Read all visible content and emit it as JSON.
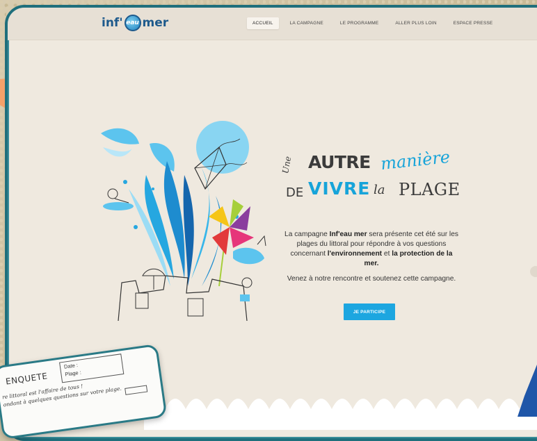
{
  "brand": {
    "logo_left": "inf'",
    "logo_globe": "eau",
    "logo_right": "mer"
  },
  "nav": {
    "items": [
      {
        "label": "ACCUEIL",
        "active": true
      },
      {
        "label": "LA CAMPAGNE",
        "active": false
      },
      {
        "label": "LE PROGRAMME",
        "active": false
      },
      {
        "label": "ALLER PLUS LOIN",
        "active": false
      },
      {
        "label": "ESPACE PRESSE",
        "active": false
      }
    ]
  },
  "hero": {
    "headline": {
      "une": "Une",
      "autre": "AUTRE",
      "maniere": "manière",
      "de": "DE",
      "vivre": "VIVRE",
      "la": "la",
      "plage": "PLAGE"
    },
    "paragraph1": {
      "p1": "La campagne ",
      "b1": "Inf'eau mer",
      "p2": " sera présente cet été sur les plages du littoral pour répondre à vos questions concernant ",
      "b2": "l'environnement",
      "p3": " et ",
      "b3": "la protection de la mer."
    },
    "paragraph2": "Venez à notre rencontre et soutenez cette campagne.",
    "cta_label": "JE PARTICIPE"
  },
  "survey_card": {
    "title": "ENQUETE",
    "date_label": "Date :",
    "plage_label": "Plage :",
    "line1": "re littoral est l'affaire de tous !",
    "line2": "ondant à quelques questions sur votre plage."
  },
  "colors": {
    "accent_blue": "#1da6e0",
    "frame_teal": "#1f6f7c",
    "page_bg": "#efe9df",
    "nav_bg": "#e7e0d5",
    "orange": "#f4a16a"
  }
}
